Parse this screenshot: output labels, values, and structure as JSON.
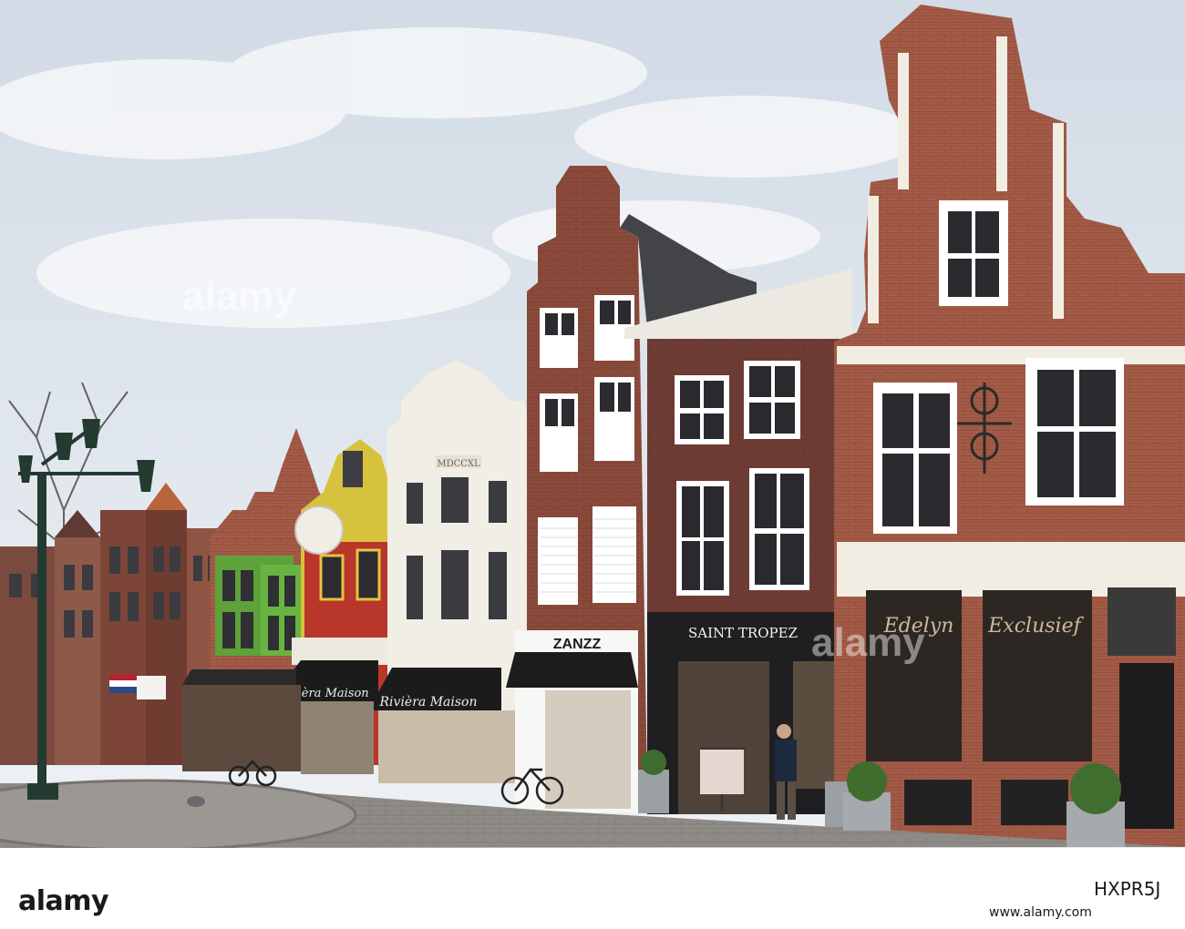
{
  "scene": {
    "description_free": true,
    "colors": {
      "sky": "#dfe5ec",
      "brick": "#8a4a3a",
      "cream": "#f2efe6",
      "awning": "#1b1b1b",
      "pavement": "#8c8783"
    }
  },
  "signs": {
    "zanzz": "ZANZZ",
    "saint_tropez": "SAINT TROPEZ",
    "riviera_1": "Rivièra Maison",
    "riviera_2": "Rivièra Maison",
    "edelyn": "Edelyn",
    "exclusief": "Exclusief",
    "date_stone": "MDCCXL"
  },
  "watermark": {
    "text_1": "alamy",
    "text_2": "alamy"
  },
  "banner": {
    "brand": "alamy",
    "image_code": "HXPR5J",
    "url": "www.alamy.com"
  }
}
